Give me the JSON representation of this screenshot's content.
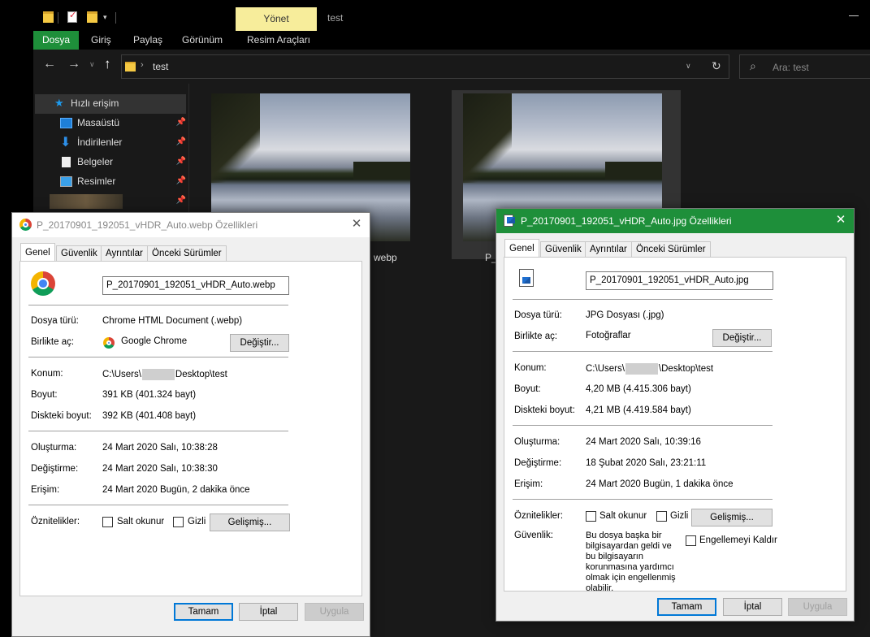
{
  "explorer": {
    "quick_access_dropdown": "▾",
    "manage_tab": "Yönet",
    "title": "test",
    "ribbon": {
      "file": "Dosya",
      "home": "Giriş",
      "share": "Paylaş",
      "view": "Görünüm",
      "picture_tools": "Resim Araçları"
    },
    "nav": {
      "back": "←",
      "forward": "→",
      "recent": "∨",
      "up": "↑"
    },
    "address": {
      "path": "test",
      "chevron": "›",
      "dropdown": "∨",
      "refresh": "↻"
    },
    "search": {
      "placeholder": "Ara: test",
      "icon": "⌕"
    },
    "sidebar": {
      "quick_access": "Hızlı erişim",
      "items": [
        {
          "label": "Masaüstü",
          "icon": "desktop-icon"
        },
        {
          "label": "İndirilenler",
          "icon": "download-icon"
        },
        {
          "label": "Belgeler",
          "icon": "documents-icon"
        },
        {
          "label": "Resimler",
          "icon": "pictures-icon"
        }
      ],
      "pin": "📌"
    },
    "files": [
      {
        "caption": "webp"
      },
      {
        "caption": "P_"
      }
    ]
  },
  "dialog_webp": {
    "title": "P_20170901_192051_vHDR_Auto.webp Özellikleri",
    "close": "✕",
    "tabs": [
      "Genel",
      "Güvenlik",
      "Ayrıntılar",
      "Önceki Sürümler"
    ],
    "filename": "P_20170901_192051_vHDR_Auto.webp",
    "type_label": "Dosya türü:",
    "type_value": "Chrome HTML Document (.webp)",
    "opens_label": "Birlikte aç:",
    "opens_value": "Google Chrome",
    "change_button": "Değiştir...",
    "location_label": "Konum:",
    "location_pre": "C:\\Users\\",
    "location_post": "Desktop\\test",
    "size_label": "Boyut:",
    "size_value": "391 KB (401.324 bayt)",
    "disk_label": "Diskteki boyut:",
    "disk_value": "392 KB (401.408 bayt)",
    "created_label": "Oluşturma:",
    "created_value": "24 Mart 2020 Salı, 10:38:28",
    "modified_label": "Değiştirme:",
    "modified_value": "24 Mart 2020 Salı, 10:38:30",
    "accessed_label": "Erişim:",
    "accessed_value": "24 Mart 2020 Bugün, 2 dakika önce",
    "attributes_label": "Öznitelikler:",
    "readonly_label": "Salt okunur",
    "hidden_label": "Gizli",
    "advanced_button": "Gelişmiş...",
    "ok_button": "Tamam",
    "cancel_button": "İptal",
    "apply_button": "Uygula"
  },
  "dialog_jpg": {
    "title": "P_20170901_192051_vHDR_Auto.jpg Özellikleri",
    "close": "✕",
    "tabs": [
      "Genel",
      "Güvenlik",
      "Ayrıntılar",
      "Önceki Sürümler"
    ],
    "filename": "P_20170901_192051_vHDR_Auto.jpg",
    "type_label": "Dosya türü:",
    "type_value": "JPG Dosyası (.jpg)",
    "opens_label": "Birlikte aç:",
    "opens_value": "Fotoğraflar",
    "change_button": "Değiştir...",
    "location_label": "Konum:",
    "location_pre": "C:\\Users\\",
    "location_post": "\\Desktop\\test",
    "size_label": "Boyut:",
    "size_value": "4,20 MB (4.415.306 bayt)",
    "disk_label": "Diskteki boyut:",
    "disk_value": "4,21 MB (4.419.584 bayt)",
    "created_label": "Oluşturma:",
    "created_value": "24 Mart 2020 Salı, 10:39:16",
    "modified_label": "Değiştirme:",
    "modified_value": "18 Şubat 2020 Salı, 23:21:11",
    "accessed_label": "Erişim:",
    "accessed_value": "24 Mart 2020 Bugün, 1 dakika önce",
    "attributes_label": "Öznitelikler:",
    "readonly_label": "Salt okunur",
    "hidden_label": "Gizli",
    "advanced_button": "Gelişmiş...",
    "security_label": "Güvenlik:",
    "security_text": "Bu dosya başka bir bilgisayardan geldi ve bu bilgisayarın korunmasına yardımcı olmak için engellenmiş olabilir.",
    "unblock_label": "Engellemeyi Kaldır",
    "ok_button": "Tamam",
    "cancel_button": "İptal",
    "apply_button": "Uygula"
  },
  "colors": {
    "explorer_bg": "#191919",
    "accent_green": "#1e8f3a",
    "manage_yellow": "#f7ed9b",
    "dialog_bg": "#f0f0f0"
  }
}
